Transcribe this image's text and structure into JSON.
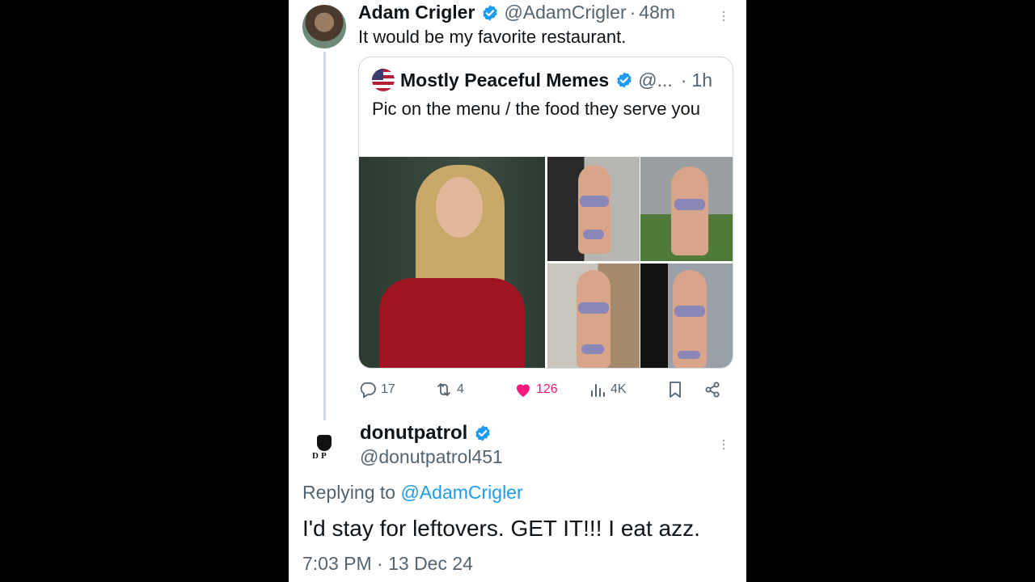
{
  "tweet": {
    "author_name": "Adam Crigler",
    "author_handle": "@AdamCrigler",
    "time_sep": "·",
    "time": "48m",
    "text": "It would be my favorite restaurant.",
    "verified": true
  },
  "quote": {
    "author_name": "Mostly Peaceful Memes",
    "author_handle": "@...",
    "time_sep": "·",
    "time": "1h",
    "text": "Pic on the menu / the food they serve you",
    "verified": true
  },
  "actions": {
    "replies": "17",
    "retweets": "4",
    "likes": "126",
    "views": "4K",
    "like_color": "#f91880"
  },
  "reply": {
    "author_name": "donutpatrol",
    "author_handle": "@donutpatrol451",
    "avatar_text": "DP",
    "replying_label": "Replying to ",
    "replying_handle": "@AdamCrigler",
    "text": "I'd stay for leftovers. GET IT!!! I eat azz.",
    "timestamp": "7:03 PM · 13 Dec 24",
    "verified": true
  },
  "colors": {
    "accent": "#1d9bf0",
    "secondary_text": "#536471",
    "border": "#cfd9de"
  }
}
